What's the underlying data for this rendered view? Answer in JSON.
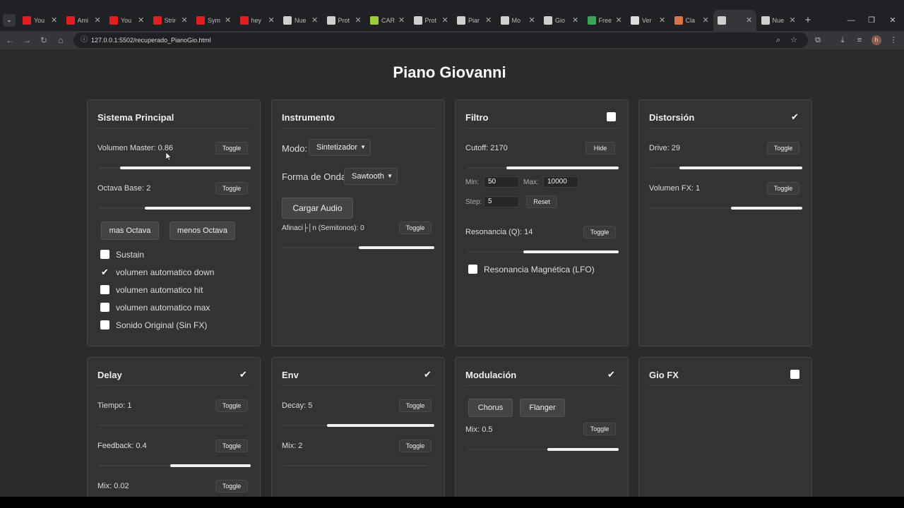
{
  "browser": {
    "tabs": [
      {
        "label": "You",
        "fav_color": "#e02020"
      },
      {
        "label": "Ami",
        "fav_color": "#e02020"
      },
      {
        "label": "You",
        "fav_color": "#e02020"
      },
      {
        "label": "Strir",
        "fav_color": "#e02020"
      },
      {
        "label": "Sym",
        "fav_color": "#e02020"
      },
      {
        "label": "hey",
        "fav_color": "#e02020"
      },
      {
        "label": "Nue",
        "fav_color": "#cfcfcf"
      },
      {
        "label": "Prot",
        "fav_color": "#cfcfcf"
      },
      {
        "label": "CAR",
        "fav_color": "#9ccc3a"
      },
      {
        "label": "Prot",
        "fav_color": "#cfcfcf"
      },
      {
        "label": "Piar",
        "fav_color": "#cfcfcf"
      },
      {
        "label": "Mo",
        "fav_color": "#cfcfcf"
      },
      {
        "label": "Gio",
        "fav_color": "#cfcfcf"
      },
      {
        "label": "Free",
        "fav_color": "#3aa655"
      },
      {
        "label": "Ver",
        "fav_color": "#dddddd"
      },
      {
        "label": "Cla",
        "fav_color": "#d9744a"
      },
      {
        "label": "",
        "fav_color": "#cfcfcf"
      },
      {
        "label": "Nue",
        "fav_color": "#cfcfcf"
      }
    ],
    "active_tab": 16,
    "url": "127.0.0.1:5502/recuperado_PianoGio.html",
    "avatar_letter": "h"
  },
  "page": {
    "title": "Piano Giovanni",
    "toggle_label": "Toggle",
    "sistema": {
      "title": "Sistema Principal",
      "volumen_master": {
        "label": "Volumen Master: 0.86",
        "value": 0.86
      },
      "octava_base": {
        "label": "Octava Base: 2",
        "value": 0.7
      },
      "mas_octava": "mas Octava",
      "menos_octava": "menos Octava",
      "checks": [
        {
          "label": "Sustain",
          "checked": false
        },
        {
          "label": "volumen automatico down",
          "checked": true
        },
        {
          "label": "volumen automatico hit",
          "checked": false
        },
        {
          "label": "volumen automatico max",
          "checked": false
        },
        {
          "label": "Sonido Original (Sin FX)",
          "checked": false
        }
      ]
    },
    "instrumento": {
      "title": "Instrumento",
      "modo_label": "Modo:",
      "modo_value": "Sintetizador",
      "onda_label": "Forma de Onda:",
      "onda_value": "Sawtooth",
      "cargar_audio": "Cargar Audio",
      "afinacion": {
        "label": "Afinaci├│n (Semitonos): 0",
        "value": 0.5
      }
    },
    "filtro": {
      "title": "Filtro",
      "enabled": false,
      "cutoff": {
        "label": "Cutoff: 2170",
        "value": 0.74
      },
      "hide_label": "Hide",
      "min_label": "Min:",
      "min_value": "50",
      "max_label": "Max:",
      "max_value": "10000",
      "step_label": "Step:",
      "step_value": "5",
      "reset_label": "Reset",
      "resonancia": {
        "label": "Resonancia (Q): 14",
        "value": 0.63
      },
      "lfo_label": "Resonancia Magnética (LFO)",
      "lfo_checked": false
    },
    "distorsion": {
      "title": "Distorsión",
      "enabled": true,
      "drive": {
        "label": "Drive: 29",
        "value": 0.81
      },
      "volumen_fx": {
        "label": "Volumen FX: 1",
        "value": 0.47
      }
    },
    "delay": {
      "title": "Delay",
      "enabled": true,
      "tiempo": {
        "label": "Tiempo: 1",
        "value": 0.0
      },
      "feedback": {
        "label": "Feedback: 0.4",
        "value": 0.53
      },
      "mix": {
        "label": "Mix: 0.02"
      }
    },
    "env": {
      "title": "Env",
      "enabled": true,
      "decay": {
        "label": "Decay: 5",
        "value": 0.71
      },
      "mix": {
        "label": "Mix: 2",
        "value": 0.0
      }
    },
    "modulacion": {
      "title": "Modulación",
      "enabled": true,
      "chorus": "Chorus",
      "flanger": "Flanger",
      "mix": {
        "label": "Mix: 0.5",
        "value": 0.47
      }
    },
    "giofx": {
      "title": "Gio FX",
      "enabled": false
    }
  }
}
